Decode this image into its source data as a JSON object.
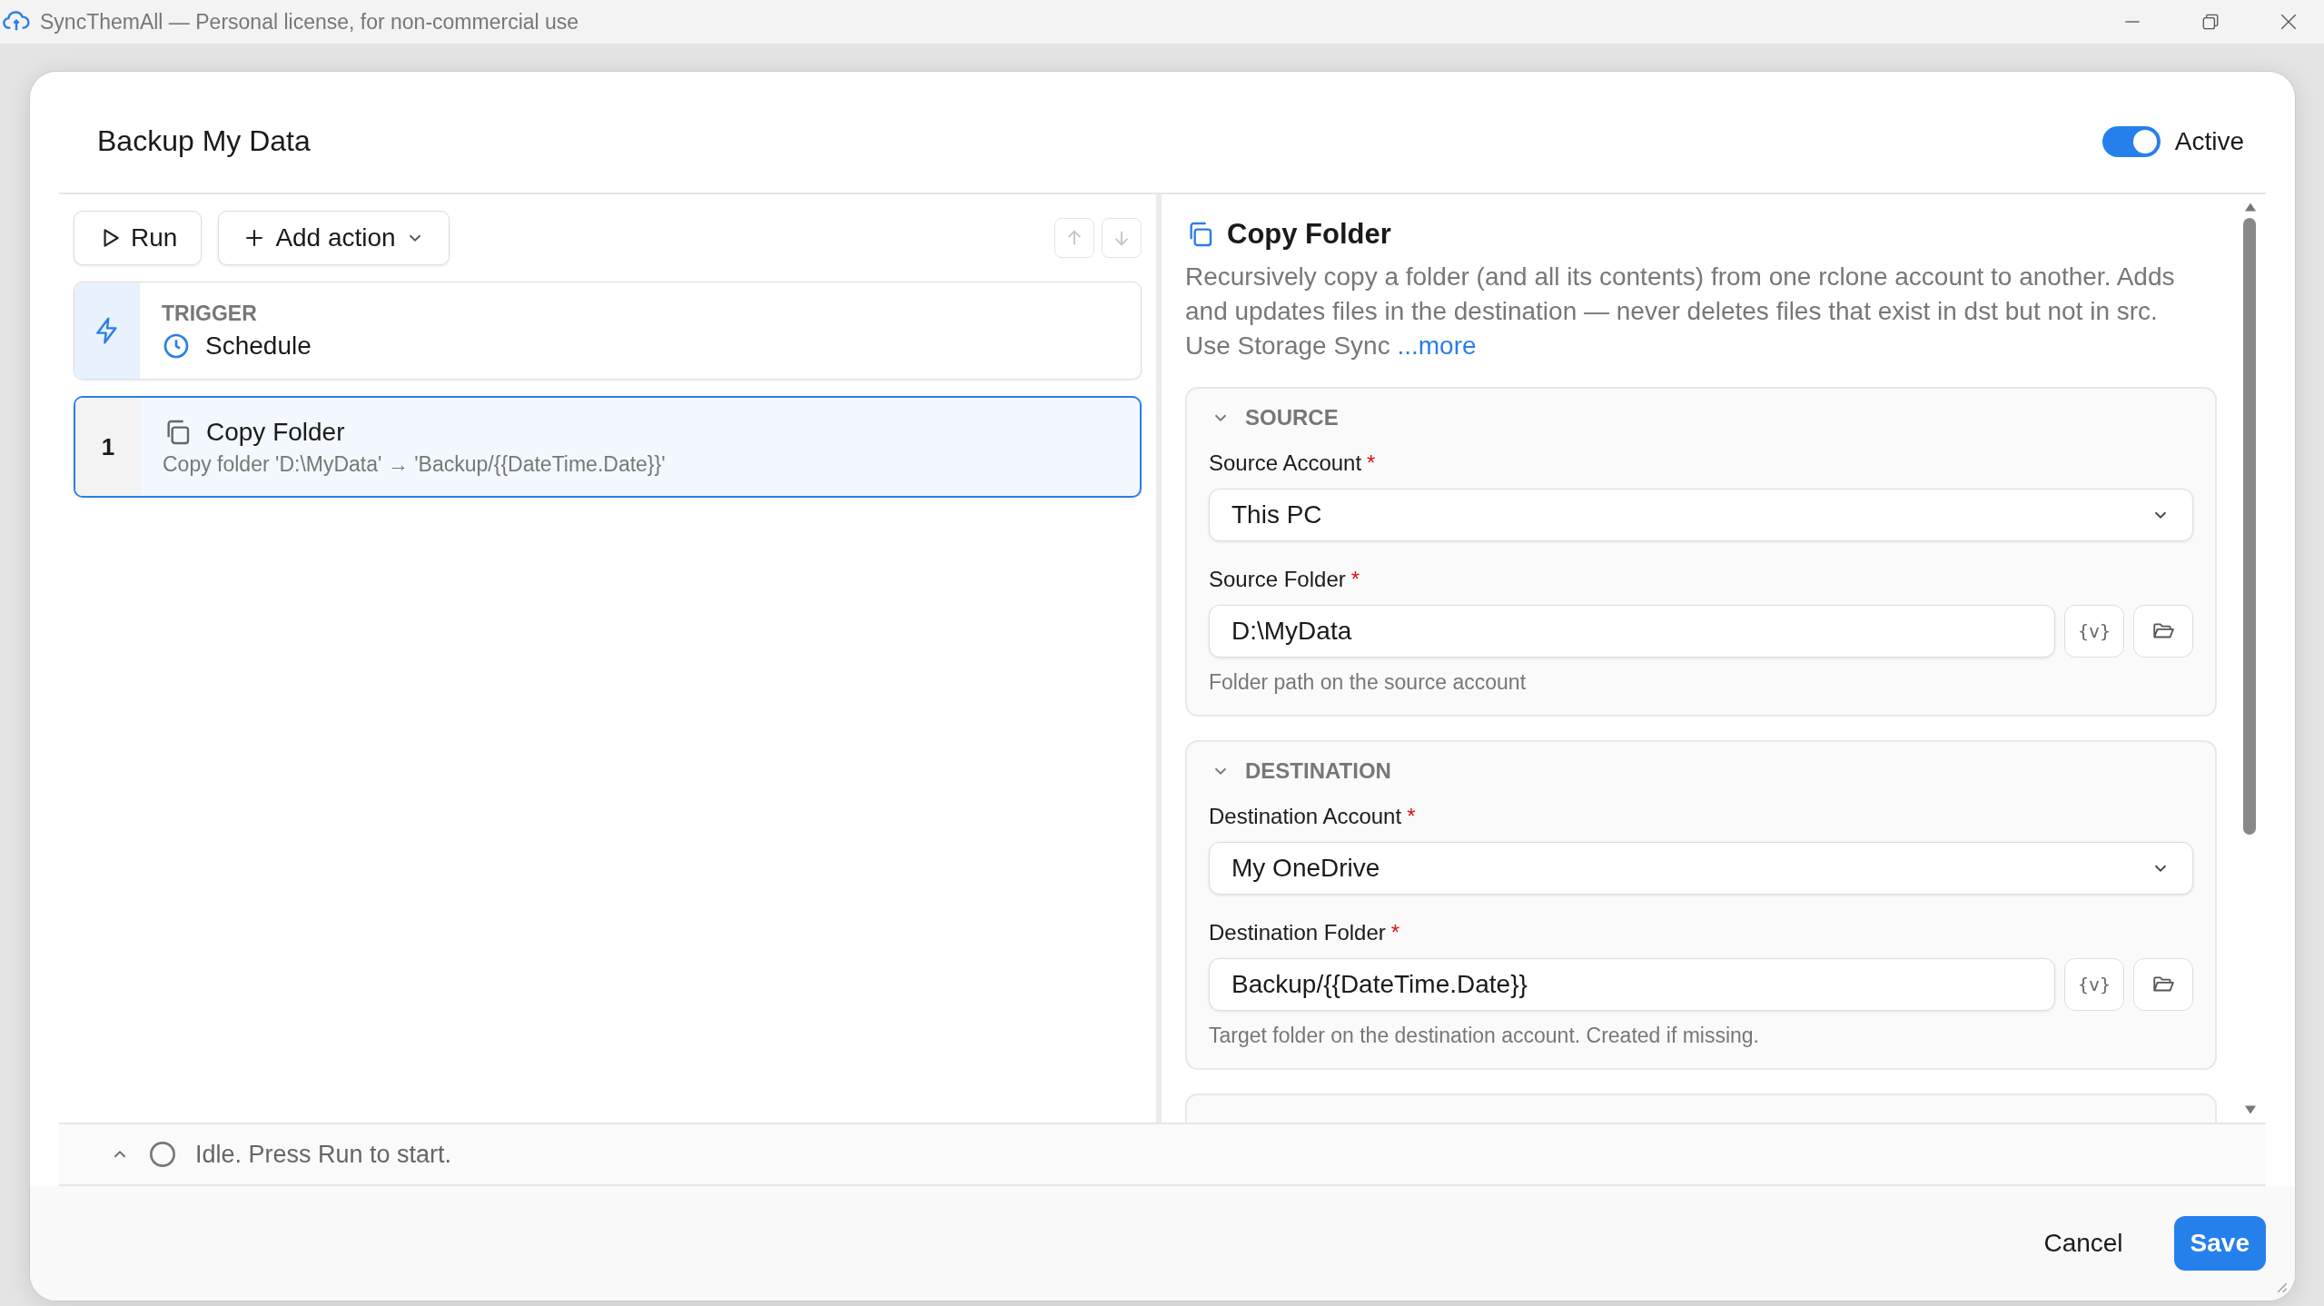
{
  "window": {
    "title": "SyncThemAll — Personal license, for non-commercial use"
  },
  "dialog": {
    "title": "Backup My Data",
    "active_toggle": {
      "label": "Active",
      "on": true
    }
  },
  "toolbar": {
    "buttons": [
      {
        "label": "Run",
        "kind": "run"
      },
      {
        "label": "Add action",
        "kind": "add"
      }
    ],
    "move_buttons": [
      {
        "kind": "up",
        "disabled": true
      },
      {
        "kind": "down",
        "disabled": true
      }
    ]
  },
  "steps": [
    {
      "kind": "trigger",
      "caption": "TRIGGER",
      "title": "Schedule",
      "selected": false
    },
    {
      "kind": "action",
      "index": "1",
      "title": "Copy Folder",
      "detail": "Copy folder 'D:\\MyData' → 'Backup/{{DateTime.Date}}'",
      "selected": true
    }
  ],
  "detail": {
    "title": "Copy Folder",
    "description": "Recursively copy a folder (and all its contents) from one rclone account to another. Adds and updates files in the destination — never deletes files that exist in dst but not in src. Use Storage Sync",
    "more_link": "...more",
    "sections": [
      {
        "title": "SOURCE",
        "expanded": true,
        "fields": [
          {
            "kind": "select",
            "label": "Source Account",
            "required_mark": "*",
            "value": "This PC"
          },
          {
            "kind": "folder",
            "label": "Source Folder",
            "required_mark": "*",
            "value": "D:\\MyData",
            "variable_button": "{v}",
            "hint": "Folder path on the source account"
          }
        ]
      },
      {
        "title": "DESTINATION",
        "expanded": true,
        "fields": [
          {
            "kind": "select",
            "label": "Destination Account",
            "required_mark": "*",
            "value": "My OneDrive"
          },
          {
            "kind": "folder",
            "label": "Destination Folder",
            "required_mark": "*",
            "value": "Backup/{{DateTime.Date}}",
            "variable_button": "{v}",
            "hint": "Target folder on the destination account. Created if missing."
          }
        ]
      }
    ]
  },
  "status": {
    "expanded": false,
    "text": "Idle. Press Run to start."
  },
  "footer": {
    "buttons": [
      {
        "label": "Cancel",
        "kind": "secondary"
      },
      {
        "label": "Save",
        "kind": "primary"
      }
    ]
  }
}
